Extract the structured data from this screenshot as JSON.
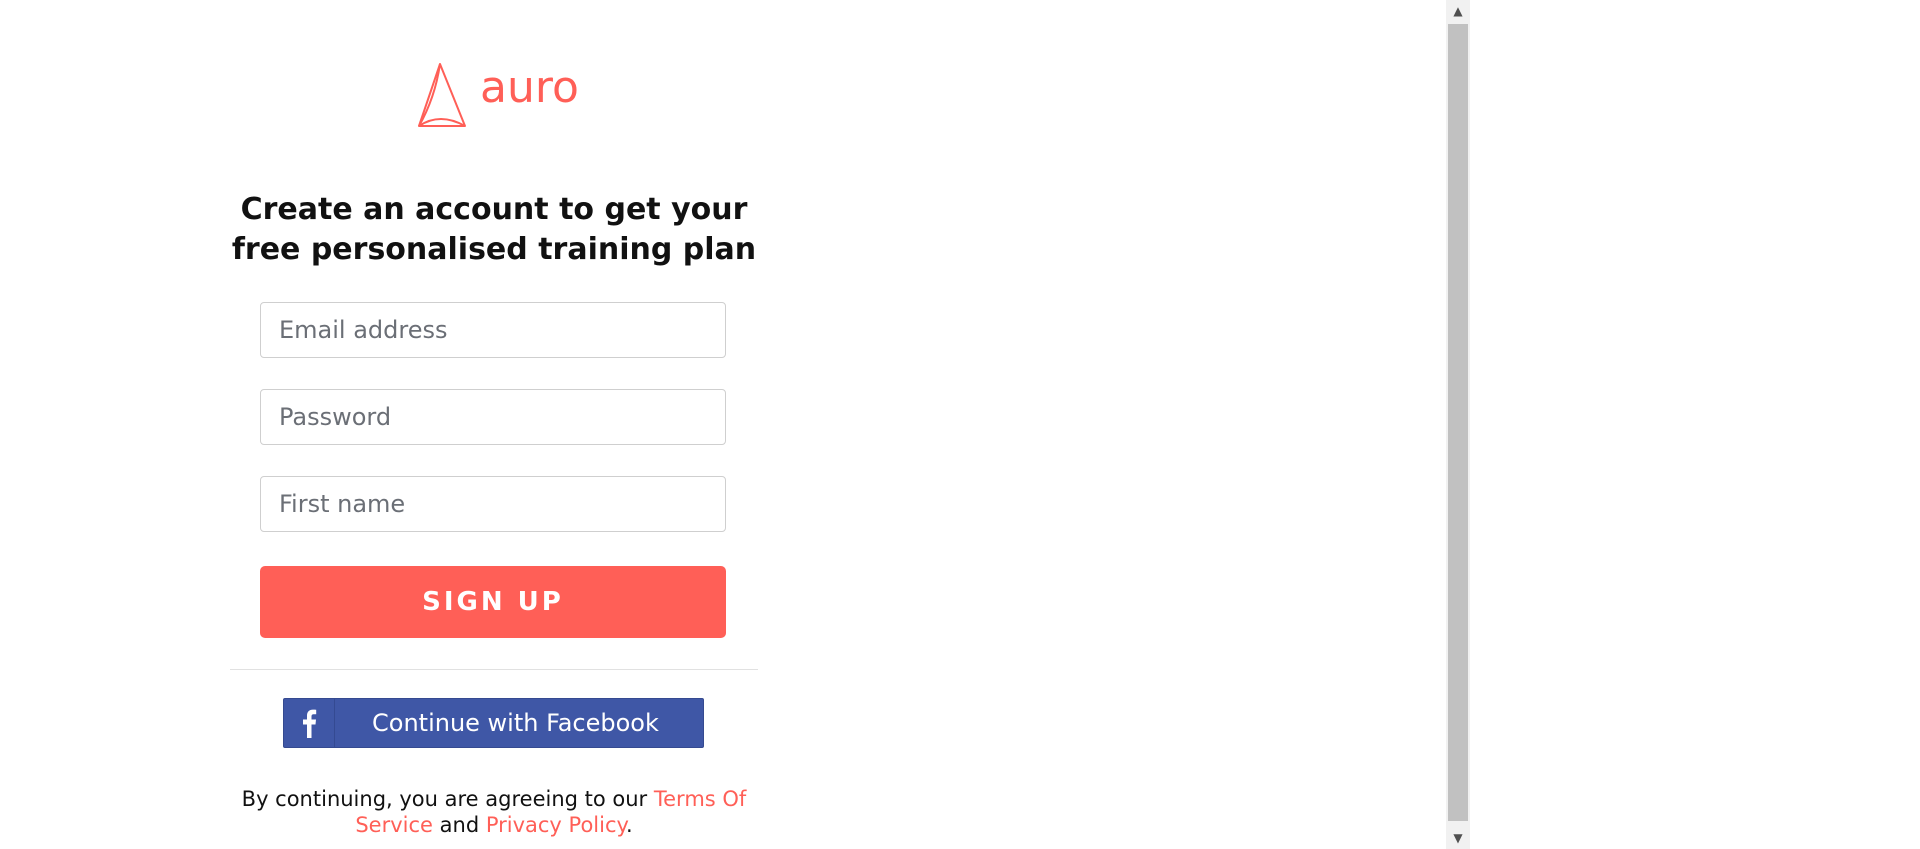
{
  "brand": {
    "name": "auro",
    "color": "#ff5f57"
  },
  "heading": {
    "line1": "Create an account to get your",
    "line2": "free personalised training plan"
  },
  "form": {
    "email_placeholder": "Email address",
    "email_value": "",
    "password_placeholder": "Password",
    "password_value": "",
    "firstname_placeholder": "First name",
    "firstname_value": "",
    "signup_label": "SIGN UP"
  },
  "facebook": {
    "label": "Continue with Facebook",
    "icon": "facebook-f-icon",
    "color": "#3f57a6"
  },
  "terms": {
    "prefix": "By continuing, you are agreeing to our ",
    "tos_link": "Terms Of Service",
    "middle": " and ",
    "privacy_link": "Privacy Policy",
    "suffix": "."
  },
  "scrollbar": {
    "up_icon": "▲",
    "down_icon": "▼"
  }
}
